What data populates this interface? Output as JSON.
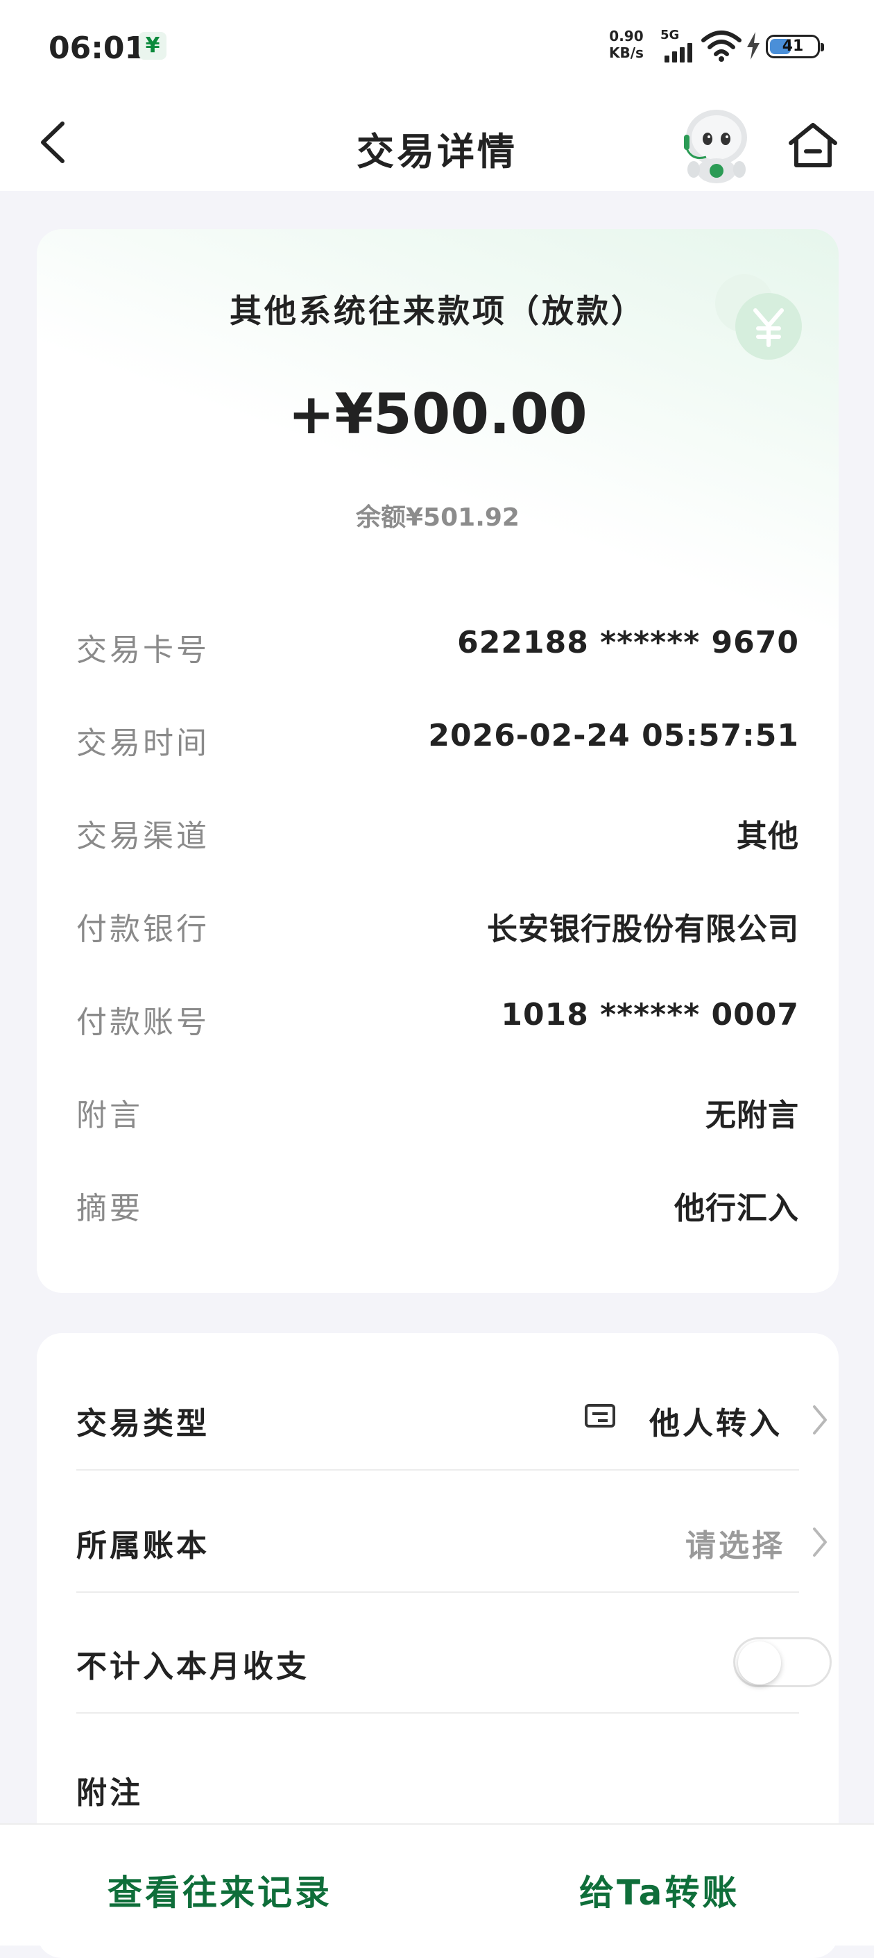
{
  "status_bar": {
    "time": "06:01",
    "network_speed_value": "0.90",
    "network_speed_unit": "KB/s",
    "network_type": "5G",
    "battery_level": "41",
    "icons": [
      "postal-app-icon",
      "signal-icon",
      "wifi-icon",
      "charging-icon",
      "battery-icon"
    ]
  },
  "nav": {
    "title": "交易详情",
    "icons": [
      "back-arrow-icon",
      "robot-mascot-icon",
      "home-icon"
    ]
  },
  "transaction": {
    "title": "其他系统往来款项（放款）",
    "amount": "+¥500.00",
    "balance": "余额¥501.92",
    "details": [
      {
        "label": "交易卡号",
        "value": "622188 ****** 9670"
      },
      {
        "label": "交易时间",
        "value": "2026-02-24 05:57:51"
      },
      {
        "label": "交易渠道",
        "value": "其他"
      },
      {
        "label": "付款银行",
        "value": "长安银行股份有限公司"
      },
      {
        "label": "付款账号",
        "value": "1018 ****** 0007"
      },
      {
        "label": "附言",
        "value": "无附言"
      },
      {
        "label": "摘要",
        "value": "他行汇入"
      }
    ]
  },
  "settings": {
    "type_label": "交易类型",
    "type_value": "他人转入",
    "ledger_label": "所属账本",
    "ledger_value": "请选择",
    "exclude_label": "不计入本月收支",
    "exclude_enabled": false,
    "note_label": "附注"
  },
  "bottom": {
    "history_button": "查看往来记录",
    "transfer_button": "给Ta转账"
  },
  "colors": {
    "accent_green": "#0f6e3a",
    "page_background": "#f4f4f9"
  }
}
